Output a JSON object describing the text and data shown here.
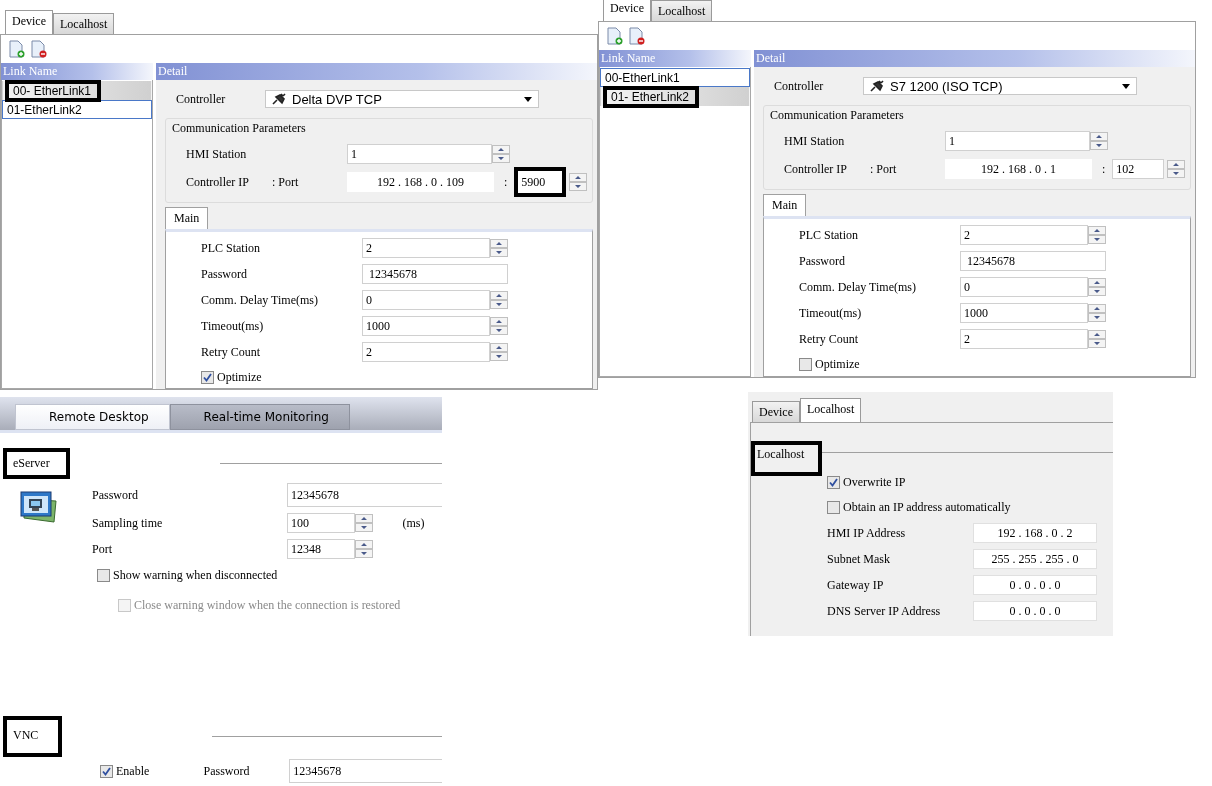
{
  "panels": [
    {
      "kind": "device",
      "tabs": [
        {
          "label": "Device",
          "selected": true
        },
        {
          "label": "Localhost",
          "selected": false
        }
      ],
      "link_header": "Link Name",
      "links": [
        {
          "label": "00- EtherLink1",
          "selected": true,
          "focused": false,
          "highlighted": true
        },
        {
          "label": "01-EtherLink2",
          "selected": false,
          "focused": true,
          "highlighted": false
        }
      ],
      "detail_header": "Detail",
      "controller": {
        "label": "Controller",
        "value": "Delta DVP TCP"
      },
      "comm": {
        "title": "Communication Parameters",
        "hmi_label": "HMI Station",
        "hmi_value": "1",
        "ip_label": "Controller IP",
        "port_label": ": Port",
        "ip": "192 . 168 . 0 . 109",
        "separator": ":",
        "port": "5900",
        "port_highlighted": true
      },
      "sub_tab": "Main",
      "fields": [
        {
          "kind": "spin",
          "label": "PLC Station",
          "value": "2"
        },
        {
          "kind": "text",
          "label": "Password",
          "value": "12345678"
        },
        {
          "kind": "spin",
          "label": "Comm. Delay Time(ms)",
          "value": "0"
        },
        {
          "kind": "spin",
          "label": "Timeout(ms)",
          "value": "1000"
        },
        {
          "kind": "spin",
          "label": "Retry Count",
          "value": "2"
        }
      ],
      "optimize": {
        "label": "Optimize",
        "checked": true
      }
    },
    {
      "kind": "device",
      "tabs": [
        {
          "label": "Device",
          "selected": true
        },
        {
          "label": "Localhost",
          "selected": false
        }
      ],
      "link_header": "Link Name",
      "links": [
        {
          "label": "00-EtherLink1",
          "selected": false,
          "focused": true,
          "highlighted": false
        },
        {
          "label": "01- EtherLink2",
          "selected": true,
          "focused": false,
          "highlighted": true
        }
      ],
      "detail_header": "Detail",
      "controller": {
        "label": "Controller",
        "value": "S7 1200 (ISO TCP)"
      },
      "comm": {
        "title": "Communication Parameters",
        "hmi_label": "HMI Station",
        "hmi_value": "1",
        "ip_label": "Controller IP",
        "port_label": ": Port",
        "ip": "192 . 168 . 0 . 1",
        "separator": ":",
        "port": "102",
        "port_highlighted": false
      },
      "sub_tab": "Main",
      "fields": [
        {
          "kind": "spin",
          "label": "PLC Station",
          "value": "2"
        },
        {
          "kind": "text",
          "label": "Password",
          "value": "12345678"
        },
        {
          "kind": "spin",
          "label": "Comm. Delay Time(ms)",
          "value": "0"
        },
        {
          "kind": "spin",
          "label": "Timeout(ms)",
          "value": "1000"
        },
        {
          "kind": "spin",
          "label": "Retry Count",
          "value": "2"
        }
      ],
      "optimize": {
        "label": "Optimize",
        "checked": false
      }
    },
    {
      "kind": "remote",
      "tabs": [
        {
          "label": "Remote Desktop",
          "selected": true
        },
        {
          "label": "Real-time Monitoring",
          "selected": false
        }
      ],
      "eserver": {
        "title": "eServer",
        "highlighted": true,
        "password_label": "Password",
        "password": "12345678",
        "sampling_label": "Sampling time",
        "sampling": "100",
        "sampling_unit": "(ms)",
        "port_label": "Port",
        "port": "12348",
        "options": [
          {
            "label": "Show warning when disconnected",
            "checked": false,
            "disabled": false
          },
          {
            "label": "Close warning window when the connection is restored",
            "checked": false,
            "disabled": true
          }
        ]
      },
      "vnc": {
        "title": "VNC",
        "highlighted": true,
        "enable": {
          "label": "Enable",
          "checked": true
        },
        "password_label": "Password",
        "password": "12345678"
      }
    },
    {
      "kind": "localhost",
      "tabs": [
        {
          "label": "Device",
          "selected": false
        },
        {
          "label": "Localhost",
          "selected": true
        }
      ],
      "section": {
        "title": "Localhost",
        "highlighted": true
      },
      "options": [
        {
          "label": "Overwrite IP",
          "checked": true
        },
        {
          "label": "Obtain an IP address automatically",
          "checked": false
        }
      ],
      "addresses": [
        {
          "label": "HMI IP Address",
          "value": "192 . 168 . 0 . 2"
        },
        {
          "label": "Subnet Mask",
          "value": "255 . 255 . 255 . 0"
        },
        {
          "label": "Gateway IP",
          "value": "0 . 0 . 0 . 0"
        },
        {
          "label": "DNS Server IP Address",
          "value": "0 . 0 . 0 . 0"
        }
      ]
    }
  ]
}
